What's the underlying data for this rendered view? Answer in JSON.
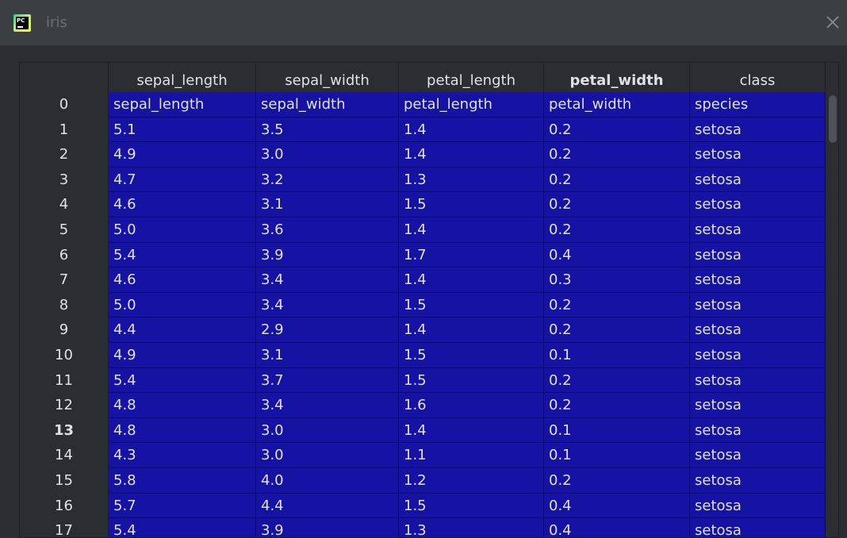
{
  "window": {
    "title": "iris"
  },
  "columns": [
    "sepal_length",
    "sepal_width",
    "petal_length",
    "petal_width",
    "class"
  ],
  "highlighted_column": 3,
  "highlighted_row": 13,
  "rows": [
    {
      "index": "0",
      "cells": [
        "sepal_length",
        "sepal_width",
        "petal_length",
        "petal_width",
        "species"
      ]
    },
    {
      "index": "1",
      "cells": [
        "5.1",
        "3.5",
        "1.4",
        "0.2",
        "setosa"
      ]
    },
    {
      "index": "2",
      "cells": [
        "4.9",
        "3.0",
        "1.4",
        "0.2",
        "setosa"
      ]
    },
    {
      "index": "3",
      "cells": [
        "4.7",
        "3.2",
        "1.3",
        "0.2",
        "setosa"
      ]
    },
    {
      "index": "4",
      "cells": [
        "4.6",
        "3.1",
        "1.5",
        "0.2",
        "setosa"
      ]
    },
    {
      "index": "5",
      "cells": [
        "5.0",
        "3.6",
        "1.4",
        "0.2",
        "setosa"
      ]
    },
    {
      "index": "6",
      "cells": [
        "5.4",
        "3.9",
        "1.7",
        "0.4",
        "setosa"
      ]
    },
    {
      "index": "7",
      "cells": [
        "4.6",
        "3.4",
        "1.4",
        "0.3",
        "setosa"
      ]
    },
    {
      "index": "8",
      "cells": [
        "5.0",
        "3.4",
        "1.5",
        "0.2",
        "setosa"
      ]
    },
    {
      "index": "9",
      "cells": [
        "4.4",
        "2.9",
        "1.4",
        "0.2",
        "setosa"
      ]
    },
    {
      "index": "10",
      "cells": [
        "4.9",
        "3.1",
        "1.5",
        "0.1",
        "setosa"
      ]
    },
    {
      "index": "11",
      "cells": [
        "5.4",
        "3.7",
        "1.5",
        "0.2",
        "setosa"
      ]
    },
    {
      "index": "12",
      "cells": [
        "4.8",
        "3.4",
        "1.6",
        "0.2",
        "setosa"
      ]
    },
    {
      "index": "13",
      "cells": [
        "4.8",
        "3.0",
        "1.4",
        "0.1",
        "setosa"
      ]
    },
    {
      "index": "14",
      "cells": [
        "4.3",
        "3.0",
        "1.1",
        "0.1",
        "setosa"
      ]
    },
    {
      "index": "15",
      "cells": [
        "5.8",
        "4.0",
        "1.2",
        "0.2",
        "setosa"
      ]
    },
    {
      "index": "16",
      "cells": [
        "5.7",
        "4.4",
        "1.5",
        "0.4",
        "setosa"
      ]
    },
    {
      "index": "17",
      "cells": [
        "5.4",
        "3.9",
        "1.3",
        "0.4",
        "setosa"
      ]
    }
  ],
  "colors": {
    "cell_background": "#1612a3",
    "window_background": "#2b2d30",
    "text": "#dfe1e5"
  },
  "icons": {
    "app": "pycharm-icon",
    "close": "close-icon"
  }
}
